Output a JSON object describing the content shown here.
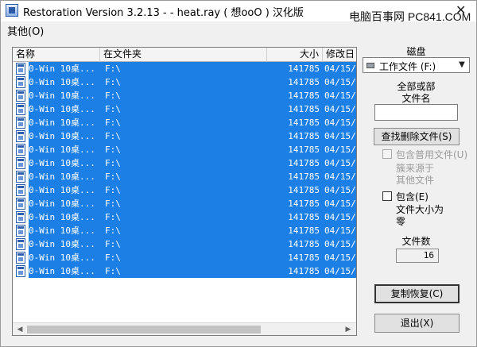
{
  "window": {
    "title": "Restoration Version 3.2.13   -  - heat.ray ( 想ooO ) 汉化版",
    "watermark": "电脑百事网 PC841.COM",
    "close_glyph": "✕"
  },
  "menu": {
    "items": [
      {
        "label": "其他(O)"
      }
    ]
  },
  "list": {
    "columns": [
      {
        "label": "名称"
      },
      {
        "label": "在文件夹"
      },
      {
        "label": "大小"
      },
      {
        "label": "修改日"
      }
    ],
    "rows": [
      {
        "name": "0-Win 10桌...",
        "folder": "F:\\",
        "size": "141785",
        "date": "04/15/"
      },
      {
        "name": "0-Win 10桌...",
        "folder": "F:\\",
        "size": "141785",
        "date": "04/15/"
      },
      {
        "name": "0-Win 10桌...",
        "folder": "F:\\",
        "size": "141785",
        "date": "04/15/"
      },
      {
        "name": "0-Win 10桌...",
        "folder": "F:\\",
        "size": "141785",
        "date": "04/15/"
      },
      {
        "name": "0-Win 10桌...",
        "folder": "F:\\",
        "size": "141785",
        "date": "04/15/"
      },
      {
        "name": "0-Win 10桌...",
        "folder": "F:\\",
        "size": "141785",
        "date": "04/15/"
      },
      {
        "name": "0-Win 10桌...",
        "folder": "F:\\",
        "size": "141785",
        "date": "04/15/"
      },
      {
        "name": "0-Win 10桌...",
        "folder": "F:\\",
        "size": "141785",
        "date": "04/15/"
      },
      {
        "name": "0-Win 10桌...",
        "folder": "F:\\",
        "size": "141785",
        "date": "04/15/"
      },
      {
        "name": "0-Win 10桌...",
        "folder": "F:\\",
        "size": "141785",
        "date": "04/15/"
      },
      {
        "name": "0-Win 10桌...",
        "folder": "F:\\",
        "size": "141785",
        "date": "04/15/"
      },
      {
        "name": "0-Win 10桌...",
        "folder": "F:\\",
        "size": "141785",
        "date": "04/15/"
      },
      {
        "name": "0-Win 10桌...",
        "folder": "F:\\",
        "size": "141785",
        "date": "04/15/"
      },
      {
        "name": "0-Win 10桌...",
        "folder": "F:\\",
        "size": "141785",
        "date": "04/15/"
      },
      {
        "name": "0-Win 10桌...",
        "folder": "F:\\",
        "size": "141785",
        "date": "04/15/"
      },
      {
        "name": "0-Win 10桌...",
        "folder": "F:\\",
        "size": "141785",
        "date": "04/15/"
      }
    ],
    "scroll_left": "◀",
    "scroll_right": "▶"
  },
  "panel": {
    "disk_label": "磁盘",
    "disk_value": "工作文件 (F:)",
    "combo_arrow": "▼",
    "filename_label_line1": "全部或部",
    "filename_label_line2": "文件名",
    "filename_value": "",
    "search_button": "查找删除文件(S)",
    "include_common_label": "包含普用文件(U)",
    "include_common_sub1": "簇来源于",
    "include_common_sub2": "其他文件",
    "include_zero_label": "包含(E)",
    "include_zero_sub1": "文件大小为",
    "include_zero_sub2": "零",
    "file_count_label": "文件数",
    "file_count_value": "16",
    "restore_button": "复制恢复(C)",
    "exit_button": "退出(X)"
  },
  "colors": {
    "selection": "#1c7fe6",
    "window_bg": "#f0f0f0"
  }
}
